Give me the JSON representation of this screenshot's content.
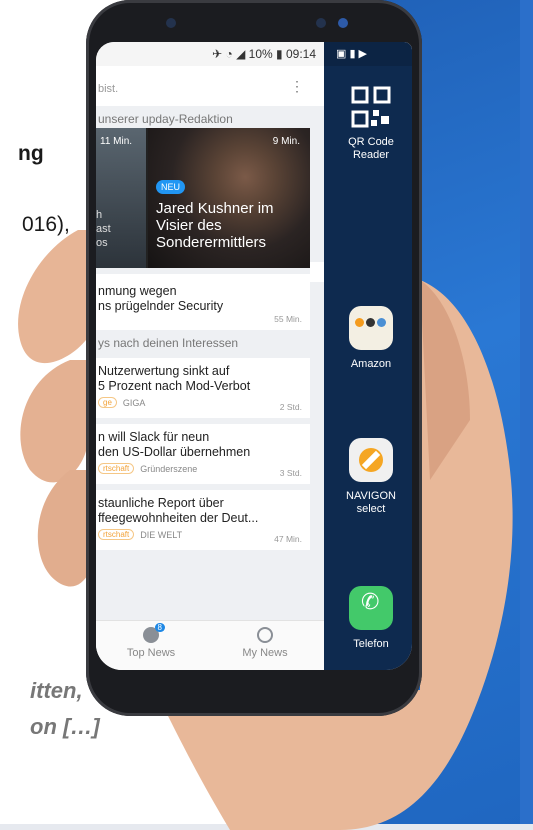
{
  "background": {
    "heading_fragment": "ng",
    "year_fragment": "016),",
    "quote_line1": "itten,",
    "quote_line2": "on […]",
    "colors": {
      "blue": "#2a78d4",
      "quote_gray": "#777777"
    }
  },
  "status_bar": {
    "indicators": "10%",
    "time": "09:14"
  },
  "news_app": {
    "header_hint": "bist.",
    "section_editorial": "unserer upday-Redaktion",
    "hero": {
      "left_time": "11 Min.",
      "left_caption": "h\nast\nos",
      "time": "9 Min.",
      "badge": "NEU",
      "title": "Jared Kushner im Visier des Sonderermittlers"
    },
    "card_1": {
      "title": "nmung wegen\nns prügelnder Security",
      "age": "55 Min."
    },
    "section_interests": "ys nach deinen Interessen",
    "cards": [
      {
        "title": "Nutzerwertung sinkt auf\n5 Prozent nach Mod-Verbot",
        "tag": "ge",
        "source": "GIGA",
        "age": "2 Std."
      },
      {
        "title": "n will Slack für neun\nden US-Dollar übernehmen",
        "tag": "rtschaft",
        "source": "Gründerszene",
        "age": "3 Std."
      },
      {
        "title": "staunliche Report über\nffeegewohnheiten der Deut...",
        "tag": "rtschaft",
        "source": "DIE WELT",
        "age": "47 Min."
      }
    ],
    "tabs": {
      "top_news": "Top News",
      "top_news_badge": "8",
      "my_news": "My News"
    }
  },
  "edge_panel": {
    "items": [
      {
        "label": "QR Code Reader",
        "icon": "qr-code-icon"
      },
      {
        "label": "Amazon",
        "icon": "folder-icon"
      },
      {
        "label": "NAVIGON select",
        "icon": "navigation-icon"
      },
      {
        "label": "Telefon",
        "icon": "phone-icon"
      }
    ]
  }
}
